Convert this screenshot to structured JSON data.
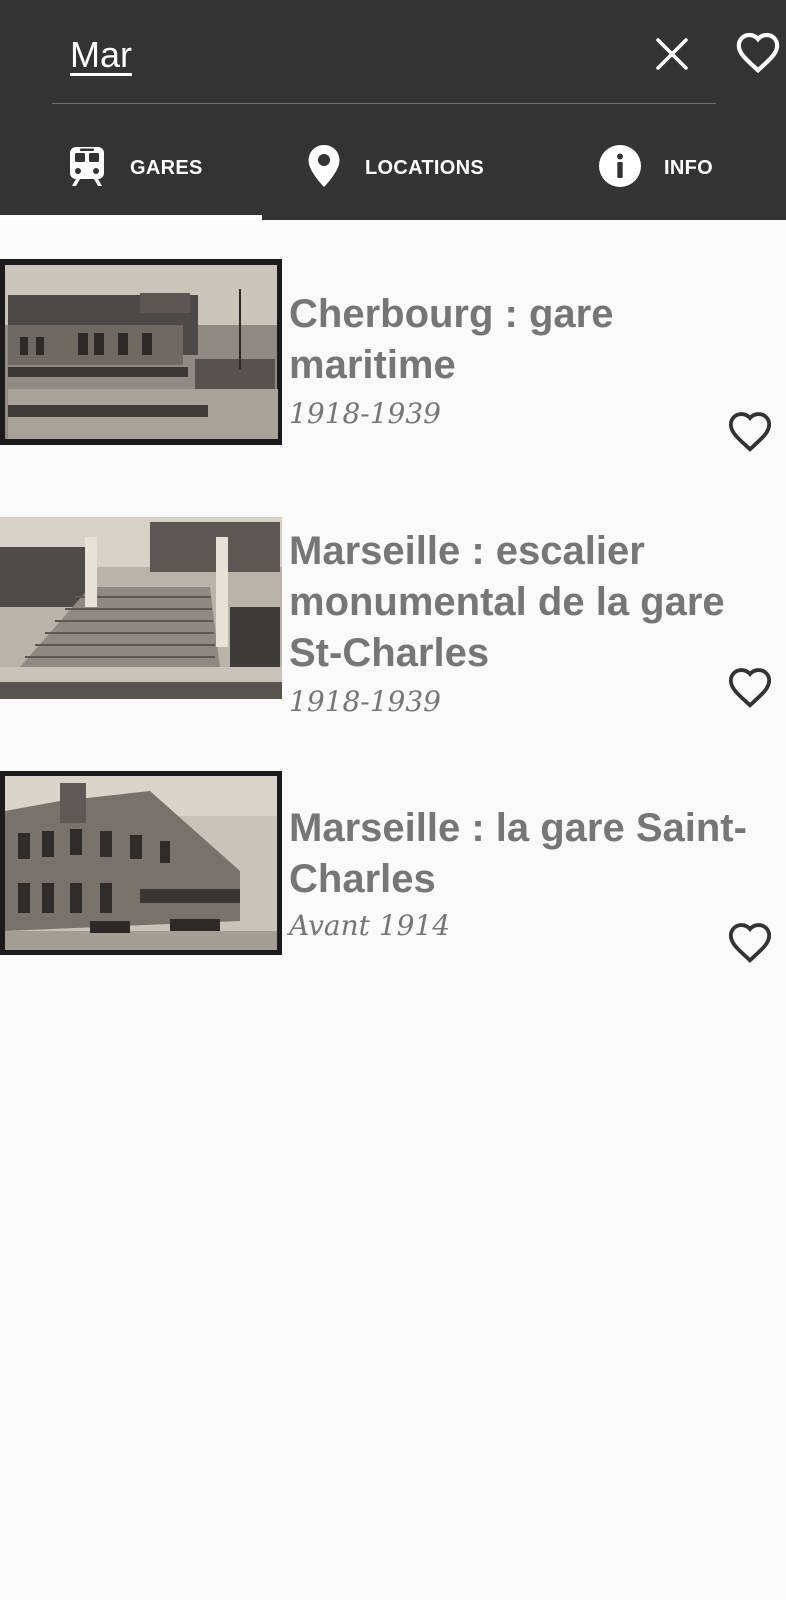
{
  "search": {
    "value": "Mar",
    "placeholder": ""
  },
  "header": {
    "clear_icon": "close-icon",
    "favorites_icon": "heart-outline-icon"
  },
  "tabs": [
    {
      "label": "GARES",
      "icon": "train-icon",
      "selected": true
    },
    {
      "label": "LOCATIONS",
      "icon": "location-pin-icon",
      "selected": false
    },
    {
      "label": "INFO",
      "icon": "info-icon",
      "selected": false
    }
  ],
  "results": [
    {
      "title": "Cherbourg : gare maritime",
      "date": "1918-1939",
      "favorite_icon": "heart-outline-icon"
    },
    {
      "title": "Marseille : escalier monumental de la gare St-Charles",
      "date": "1918-1939",
      "favorite_icon": "heart-outline-icon"
    },
    {
      "title": "Marseille : la gare Saint-Charles",
      "date": "Avant 1914",
      "favorite_icon": "heart-outline-icon"
    }
  ],
  "colors": {
    "header_bg": "#333333",
    "page_bg": "#fafafa",
    "text_grey": "#767676",
    "tab_text": "#ffffff"
  }
}
